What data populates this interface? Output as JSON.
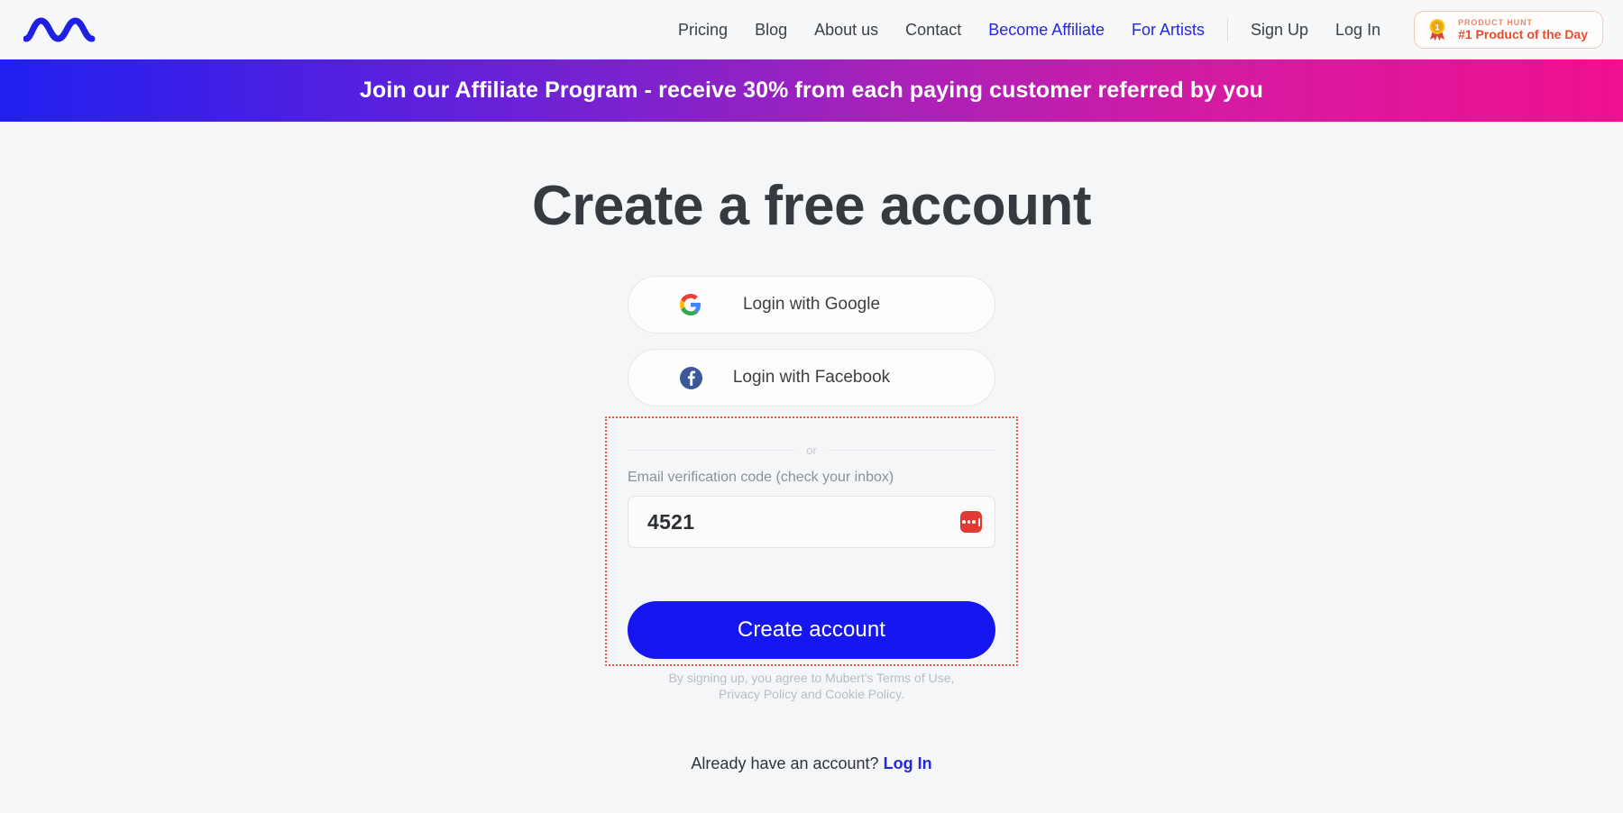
{
  "header": {
    "logo_name": "mubert-wave-logo",
    "nav_links": [
      {
        "label": "Pricing",
        "accent": false
      },
      {
        "label": "Blog",
        "accent": false
      },
      {
        "label": "About us",
        "accent": false
      },
      {
        "label": "Contact",
        "accent": false
      },
      {
        "label": "Become Affiliate",
        "accent": true
      },
      {
        "label": "For Artists",
        "accent": true
      }
    ],
    "auth_links": [
      {
        "label": "Sign Up"
      },
      {
        "label": "Log In"
      }
    ],
    "product_hunt": {
      "kicker": "PRODUCT HUNT",
      "title": "#1 Product of the Day",
      "medal_number": "1"
    }
  },
  "banner": {
    "text": "Join our Affiliate Program - receive 30% from each paying customer referred by you",
    "gradient_start": "#2020f0",
    "gradient_end": "#f01090"
  },
  "main": {
    "title": "Create a free account",
    "social_buttons": [
      {
        "label": "Login with Google",
        "icon": "google-icon"
      },
      {
        "label": "Login with Facebook",
        "icon": "facebook-icon"
      }
    ],
    "divider_label": "or",
    "code_field": {
      "label": "Email verification code (check your inbox)",
      "value": "4521",
      "placeholder": "",
      "manager_icon": "password-manager-icon"
    },
    "submit_label": "Create account",
    "terms_line1": "By signing up, you agree to Mubert's Terms of Use,",
    "terms_line2": "Privacy Policy and Cookie Policy.",
    "login_prompt_text": "Already have an account?",
    "login_prompt_link": "Log In"
  },
  "colors": {
    "primary_blue": "#1616f0",
    "accent_link": "#2626e0",
    "page_background": "#f5f6f7",
    "annotation_outline": "#f4543c",
    "product_hunt_orange": "#ea4b2e"
  }
}
